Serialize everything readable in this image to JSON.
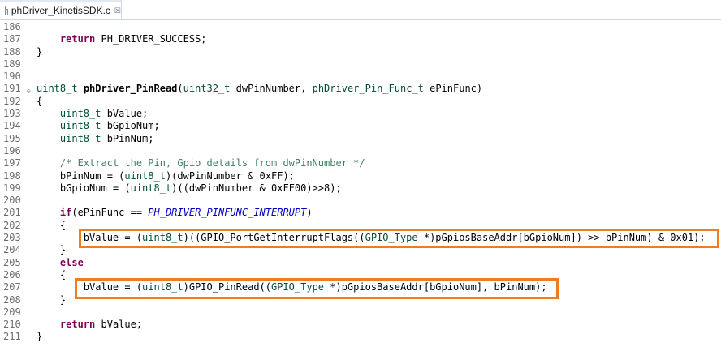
{
  "tab": {
    "filename": "phDriver_KinetisSDK.c",
    "close_glyph": "☒"
  },
  "lines": [
    {
      "n": "186",
      "segs": []
    },
    {
      "n": "187",
      "segs": [
        [
          "",
          "    "
        ],
        [
          "kw",
          "return"
        ],
        [
          "",
          " PH_DRIVER_SUCCESS;"
        ]
      ]
    },
    {
      "n": "188",
      "segs": [
        [
          "",
          "}"
        ]
      ]
    },
    {
      "n": "189",
      "segs": []
    },
    {
      "n": "190",
      "segs": []
    },
    {
      "n": "191",
      "fold": true,
      "segs": [
        [
          "ty",
          "uint8_t"
        ],
        [
          "",
          " "
        ],
        [
          "fn",
          "phDriver_PinRead"
        ],
        [
          "",
          "("
        ],
        [
          "ty",
          "uint32_t"
        ],
        [
          "",
          " dwPinNumber, "
        ],
        [
          "ty",
          "phDriver_Pin_Func_t"
        ],
        [
          "",
          " ePinFunc)"
        ]
      ]
    },
    {
      "n": "192",
      "segs": [
        [
          "",
          "{"
        ]
      ]
    },
    {
      "n": "193",
      "segs": [
        [
          "",
          "    "
        ],
        [
          "ty",
          "uint8_t"
        ],
        [
          "",
          " bValue;"
        ]
      ]
    },
    {
      "n": "194",
      "segs": [
        [
          "",
          "    "
        ],
        [
          "ty",
          "uint8_t"
        ],
        [
          "",
          " bGpioNum;"
        ]
      ]
    },
    {
      "n": "195",
      "segs": [
        [
          "",
          "    "
        ],
        [
          "ty",
          "uint8_t"
        ],
        [
          "",
          " bPinNum;"
        ]
      ]
    },
    {
      "n": "196",
      "segs": []
    },
    {
      "n": "197",
      "segs": [
        [
          "",
          "    "
        ],
        [
          "cm",
          "/* Extract the Pin, Gpio details from dwPinNumber */"
        ]
      ]
    },
    {
      "n": "198",
      "segs": [
        [
          "",
          "    bPinNum = ("
        ],
        [
          "ty",
          "uint8_t"
        ],
        [
          "",
          ")(dwPinNumber & 0xFF);"
        ]
      ]
    },
    {
      "n": "199",
      "segs": [
        [
          "",
          "    bGpioNum = ("
        ],
        [
          "ty",
          "uint8_t"
        ],
        [
          "",
          ")((dwPinNumber & 0xFF00)>>8);"
        ]
      ]
    },
    {
      "n": "200",
      "segs": []
    },
    {
      "n": "201",
      "segs": [
        [
          "",
          "    "
        ],
        [
          "kw",
          "if"
        ],
        [
          "",
          "(ePinFunc == "
        ],
        [
          "mc",
          "PH_DRIVER_PINFUNC_INTERRUPT"
        ],
        [
          "",
          ")"
        ]
      ]
    },
    {
      "n": "202",
      "segs": [
        [
          "",
          "    {"
        ]
      ]
    },
    {
      "n": "203",
      "segs": [
        [
          "",
          "        bValue = ("
        ],
        [
          "ty",
          "uint8_t"
        ],
        [
          "",
          ")((GPIO_PortGetInterruptFlags(("
        ],
        [
          "ty",
          "GPIO_Type"
        ],
        [
          "",
          " *)pGpiosBaseAddr[bGpioNum]) >> bPinNum) & 0x01);"
        ]
      ]
    },
    {
      "n": "204",
      "segs": [
        [
          "",
          "    }"
        ]
      ]
    },
    {
      "n": "205",
      "segs": [
        [
          "",
          "    "
        ],
        [
          "kw",
          "else"
        ]
      ]
    },
    {
      "n": "206",
      "segs": [
        [
          "",
          "    {"
        ]
      ]
    },
    {
      "n": "207",
      "segs": [
        [
          "",
          "        bValue = ("
        ],
        [
          "ty",
          "uint8_t"
        ],
        [
          "",
          ")GPIO_PinRead(("
        ],
        [
          "ty",
          "GPIO_Type"
        ],
        [
          "",
          " *)pGpiosBaseAddr[bGpioNum], bPinNum);"
        ]
      ]
    },
    {
      "n": "208",
      "segs": [
        [
          "",
          "    }"
        ]
      ]
    },
    {
      "n": "209",
      "segs": []
    },
    {
      "n": "210",
      "segs": [
        [
          "",
          "    "
        ],
        [
          "kw",
          "return"
        ],
        [
          "",
          " bValue;"
        ]
      ]
    },
    {
      "n": "211",
      "segs": [
        [
          "",
          "}"
        ]
      ]
    }
  ],
  "highlights": [
    "203",
    "207"
  ],
  "colors": {
    "keyword": "#7f0055",
    "type": "#005032",
    "comment": "#3f7f5f",
    "macro": "#0000c0",
    "highlight_box": "#ee7d22"
  }
}
